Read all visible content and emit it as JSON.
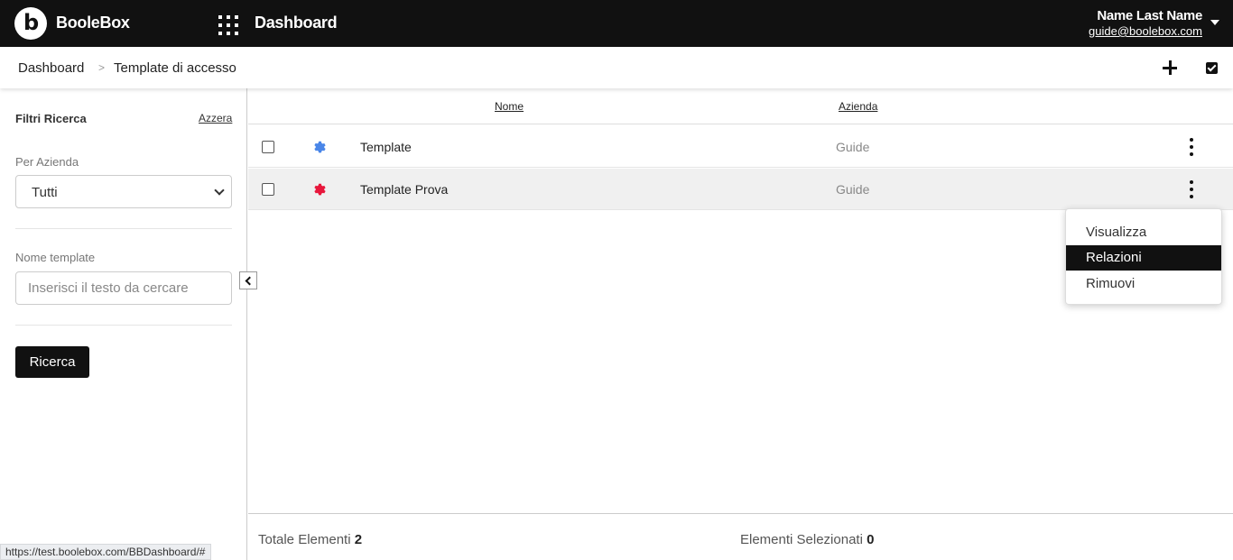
{
  "header": {
    "brand": "BooleBox",
    "logo_letter": "b",
    "title": "Dashboard",
    "user_name": "Name Last Name",
    "user_email": "guide@boolebox.com"
  },
  "breadcrumb": {
    "items": [
      "Dashboard",
      "Template di accesso"
    ],
    "separator": ">"
  },
  "filters": {
    "title": "Filtri Ricerca",
    "reset_label": "Azzera",
    "company_label": "Per Azienda",
    "company_value": "Tutti",
    "template_label": "Nome template",
    "template_placeholder": "Inserisci il testo da cercare",
    "search_button": "Ricerca"
  },
  "table": {
    "columns": [
      "Nome",
      "Azienda"
    ],
    "rows": [
      {
        "name": "Template",
        "company": "Guide",
        "icon_color": "#4a86e8",
        "icon": "gear-icon"
      },
      {
        "name": "Template Prova",
        "company": "Guide",
        "icon_color": "#e8173c",
        "icon": "gear-icon"
      }
    ]
  },
  "footer": {
    "total_label": "Totale Elementi",
    "total_value": "2",
    "selected_label": "Elementi Selezionati",
    "selected_value": "0"
  },
  "context_menu": {
    "items": [
      "Visualizza",
      "Relazioni",
      "Rimuovi"
    ],
    "active": "Relazioni"
  },
  "status_url": "https://test.boolebox.com/BBDashboard/#"
}
